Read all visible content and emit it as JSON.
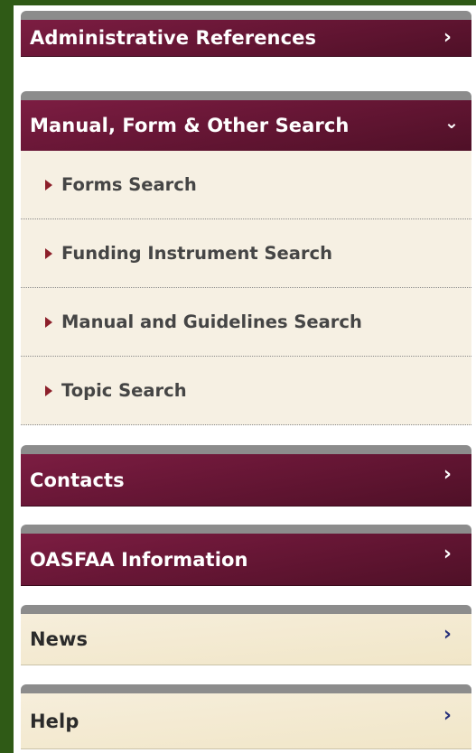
{
  "sidebar": {
    "sections": [
      {
        "label": "Administrative References",
        "chevron": "›"
      },
      {
        "label": "Manual, Form & Other Search",
        "chevron": "⌄",
        "items": [
          {
            "label": "Forms Search"
          },
          {
            "label": "Funding Instrument Search"
          },
          {
            "label": "Manual and Guidelines Search"
          },
          {
            "label": "Topic Search"
          }
        ]
      },
      {
        "label": "Contacts",
        "chevron": "›"
      },
      {
        "label": "OASFAA Information",
        "chevron": "›"
      },
      {
        "label": "News",
        "chevron": "›"
      },
      {
        "label": "Help",
        "chevron": "›"
      }
    ]
  },
  "colors": {
    "frame_green": "#2f5a16",
    "maroon": "#6a1737",
    "cream": "#f6f0e3",
    "bullet_red": "#8c1f2a",
    "light_chevron_blue": "#27307a"
  }
}
